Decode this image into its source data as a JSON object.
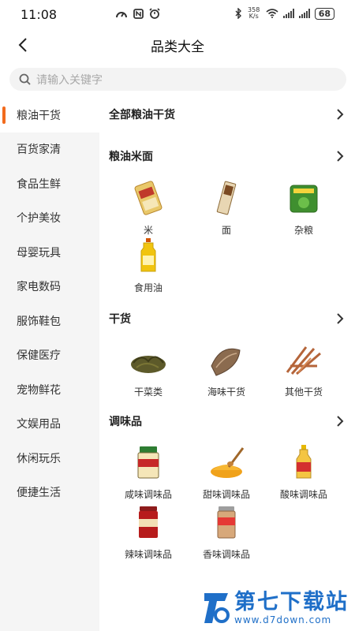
{
  "status_bar": {
    "time": "11:08",
    "net_speed_value": "358",
    "net_speed_unit": "K/s",
    "battery": "68"
  },
  "header": {
    "title": "品类大全"
  },
  "search": {
    "placeholder": "请输入关键字"
  },
  "colors": {
    "accent": "#f26b1d",
    "sidebar_bg": "#f5f5f5",
    "watermark": "#1f6fc8"
  },
  "sidebar": {
    "items": [
      {
        "label": "粮油干货"
      },
      {
        "label": "百货家清"
      },
      {
        "label": "食品生鲜"
      },
      {
        "label": "个护美妆"
      },
      {
        "label": "母婴玩具"
      },
      {
        "label": "家电数码"
      },
      {
        "label": "服饰鞋包"
      },
      {
        "label": "保健医疗"
      },
      {
        "label": "宠物鲜花"
      },
      {
        "label": "文娱用品"
      },
      {
        "label": "休闲玩乐"
      },
      {
        "label": "便捷生活"
      }
    ]
  },
  "main": {
    "all_link": "全部粮油干货",
    "sections": [
      {
        "title": "粮油米面",
        "items": [
          {
            "label": "米"
          },
          {
            "label": "面"
          },
          {
            "label": "杂粮"
          },
          {
            "label": "食用油"
          }
        ]
      },
      {
        "title": "干货",
        "items": [
          {
            "label": "干菜类"
          },
          {
            "label": "海味干货"
          },
          {
            "label": "其他干货"
          }
        ]
      },
      {
        "title": "调味品",
        "items": [
          {
            "label": "咸味调味品"
          },
          {
            "label": "甜味调味品"
          },
          {
            "label": "酸味调味品"
          },
          {
            "label": "辣味调味品"
          },
          {
            "label": "香味调味品"
          }
        ]
      }
    ]
  },
  "watermark": {
    "title": "第七下载站",
    "url": "www.d7down.com"
  }
}
